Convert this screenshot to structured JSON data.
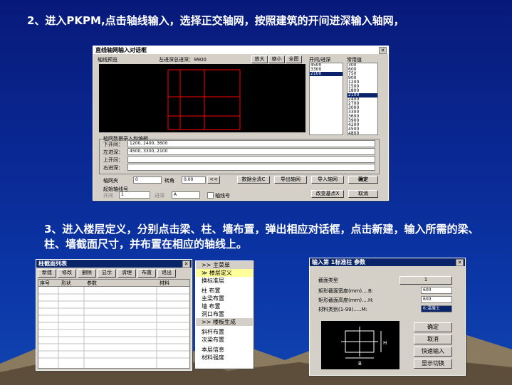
{
  "heading1": "2、进入PKPM,点击轴线输入，选择正交轴网，按照建筑的开间进深输入轴网，",
  "heading2": "3、进入楼层定义，分别点击梁、柱、墙布置，弹出相应对话框，点击新建，输入所需的梁、柱、墙截面尺寸，并布置在相应的轴线上。",
  "axis_dialog": {
    "title": "直线轴网输入对话框",
    "preview_label": "轴线预览",
    "total_depth": "左进深总进深：9900",
    "btn_zoom_in": "放大",
    "btn_zoom_out": "缩小",
    "btn_full": "全图",
    "list_label": "开间/进深",
    "common_label": "常用值",
    "list_values": [
      "4500",
      "3300",
      "2100"
    ],
    "common_values": [
      "300",
      "600",
      "750",
      "900",
      "1200",
      "1500",
      "1800",
      "2100",
      "2400",
      "2700",
      "3000",
      "3300",
      "3600",
      "3900",
      "4200",
      "4500",
      "4800",
      "5100"
    ],
    "section_label": "轴网数据录入和编辑",
    "rows": [
      {
        "label": "下开间：",
        "value": "1200, 2400, 3600"
      },
      {
        "label": "左进深：",
        "value": "4500, 3300, 2100"
      },
      {
        "label": "上开间：",
        "value": ""
      },
      {
        "label": "右进深：",
        "value": ""
      }
    ],
    "axis_angle_label": "轴网夹",
    "axis_angle_value": "0",
    "rotate_label": "转角",
    "rotate_value": "0.00",
    "arrow_btn": "<<",
    "btn_clear": "数据全清C",
    "btn_export": "导出轴网",
    "btn_import": "导入轴网",
    "btn_ok": "确定",
    "start_label": "起始轴线号",
    "start_col_label": "开间",
    "start_col_value": "1",
    "start_row_label": "进深",
    "start_row_value": "A",
    "checkbox_label": "轴线号",
    "btn_basepoint": "改变基点X",
    "btn_cancel": "取消"
  },
  "section_list": {
    "title": "柱截面列表",
    "buttons": [
      "新建",
      "修改",
      "删除",
      "显示",
      "清理",
      "布置",
      "退出"
    ],
    "columns": [
      "序号",
      "形状",
      "参数",
      "材料"
    ]
  },
  "side_menu": {
    "items": [
      {
        "label": "主菜单",
        "prefix": ">>"
      },
      {
        "label": "楼层定义",
        "prefix": "≫",
        "active": true
      },
      {
        "label": "换标准层",
        "prefix": ""
      },
      {
        "label": "",
        "prefix": ""
      },
      {
        "label": "柱  布置",
        "prefix": ""
      },
      {
        "label": "主梁布置",
        "prefix": ""
      },
      {
        "label": "墙  布置",
        "prefix": ""
      },
      {
        "label": "洞口布置",
        "prefix": ""
      },
      {
        "label": "楼板生成",
        "prefix": ">>"
      },
      {
        "label": "",
        "prefix": ""
      },
      {
        "label": "斜杆布置",
        "prefix": ""
      },
      {
        "label": "次梁布置",
        "prefix": ""
      },
      {
        "label": "",
        "prefix": ""
      },
      {
        "label": "本层信息",
        "prefix": ""
      },
      {
        "label": "材料强度",
        "prefix": ""
      }
    ]
  },
  "param_dialog": {
    "title": "输入第 1标准柱 参数",
    "section_type_label": "截面类型",
    "section_type_value": "1",
    "width_label": "矩形截面宽度(mm)....B:",
    "width_value": "600",
    "height_label": "矩形截面高度(mm)....H:",
    "height_value": "600",
    "material_label": "材料类别(1-99).....M:",
    "material_value": "6:混凝土",
    "btn_ok": "确定",
    "btn_cancel": "取消",
    "btn_quick": "快速输入",
    "btn_switch": "显示切换",
    "dim_h": "H",
    "dim_b": "B"
  },
  "colors": {
    "background": "#0a2a96",
    "dialog": "#d4d0c8",
    "title_active": "#0a246a",
    "grid": "#ff0000"
  }
}
